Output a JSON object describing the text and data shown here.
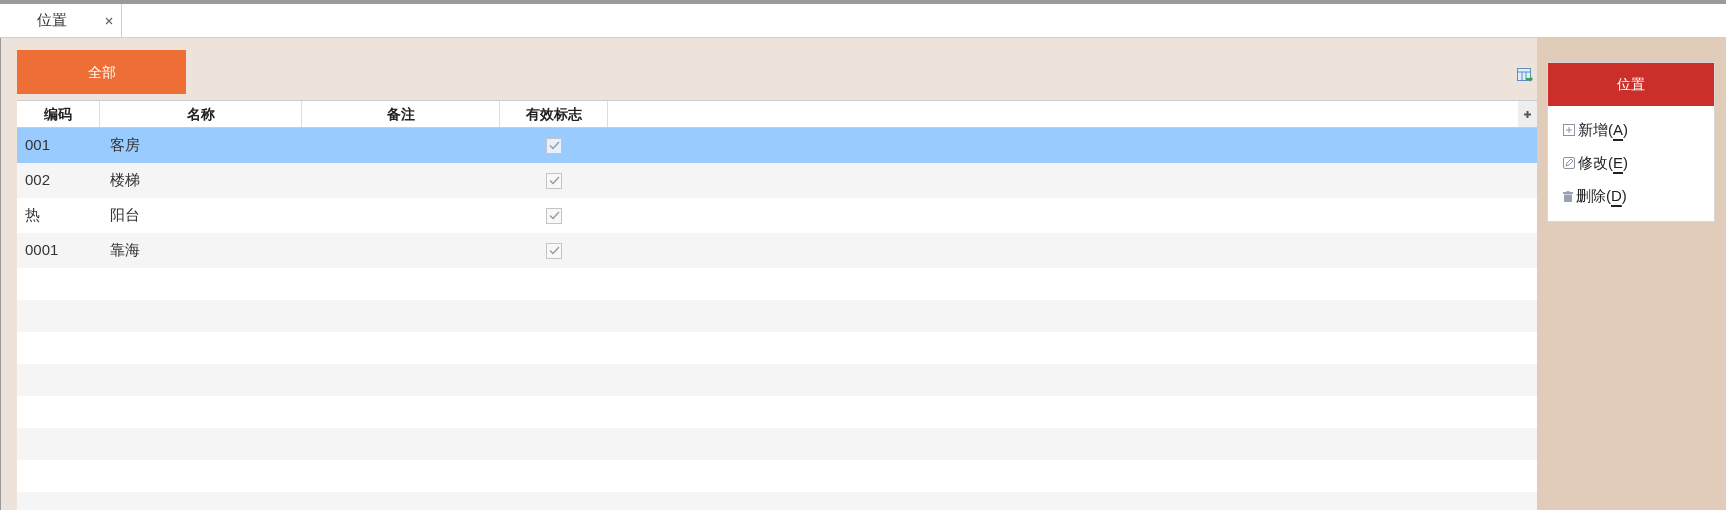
{
  "tabs": [
    {
      "label": "位置",
      "selected": true
    }
  ],
  "filter_button": {
    "label": "全部"
  },
  "table": {
    "columns": [
      "编码",
      "名称",
      "备注",
      "有效标志"
    ],
    "rows": [
      {
        "code": "001",
        "name": "客房",
        "valid": true,
        "selected": true
      },
      {
        "code": "002",
        "name": "楼梯",
        "valid": true,
        "selected": false
      },
      {
        "code": "热",
        "name": "阳台",
        "valid": true,
        "selected": false
      },
      {
        "code": "0001",
        "name": "靠海",
        "valid": true,
        "selected": false
      }
    ]
  },
  "side_panel": {
    "title": "位置",
    "actions": [
      {
        "kind": "add",
        "before": "新增(",
        "key": "A",
        "after": ")"
      },
      {
        "kind": "edit",
        "before": "修改(",
        "key": "E",
        "after": ")"
      },
      {
        "kind": "delete",
        "before": "删除(",
        "key": "D",
        "after": ")"
      }
    ]
  }
}
